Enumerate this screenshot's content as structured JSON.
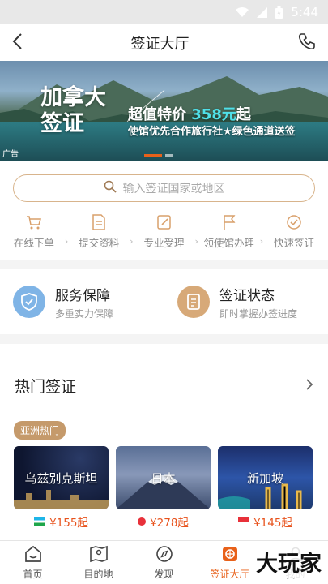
{
  "status_bar": {
    "time": "5:44"
  },
  "header": {
    "title": "签证大厅"
  },
  "banner": {
    "country_line1": "加拿大",
    "country_line2": "签证",
    "promo_prefix": "超值特价",
    "promo_price": "358元",
    "promo_suffix": "起",
    "subtitle": "使馆优先合作旅行社★绿色通道送签",
    "ad_label": "广告"
  },
  "search": {
    "placeholder": "输入签证国家或地区"
  },
  "steps": [
    {
      "label": "在线下单",
      "icon": "cart-icon"
    },
    {
      "label": "提交资料",
      "icon": "document-icon"
    },
    {
      "label": "专业受理",
      "icon": "edit-icon"
    },
    {
      "label": "领使馆办理",
      "icon": "flag-icon"
    },
    {
      "label": "快速签证",
      "icon": "check-circle-icon"
    }
  ],
  "services": [
    {
      "title": "服务保障",
      "subtitle": "多重实力保障",
      "icon": "shield-icon",
      "color": "#7fb4e6"
    },
    {
      "title": "签证状态",
      "subtitle": "即时掌握办签进度",
      "icon": "status-doc-icon",
      "color": "#d7a978"
    }
  ],
  "hot": {
    "title": "热门签证",
    "tag": "亚洲热门",
    "cards": [
      {
        "name": "乌兹别克斯坦",
        "price": "¥155起",
        "flag": "uzbekistan-flag"
      },
      {
        "name": "日本",
        "price": "¥278起",
        "flag": "japan-flag"
      },
      {
        "name": "新加坡",
        "price": "¥145起",
        "flag": "singapore-flag"
      }
    ]
  },
  "tabbar": [
    {
      "label": "首页",
      "icon": "home-icon"
    },
    {
      "label": "目的地",
      "icon": "map-icon"
    },
    {
      "label": "发现",
      "icon": "compass-icon"
    },
    {
      "label": "签证大厅",
      "icon": "visa-hall-icon"
    },
    {
      "label": "我的",
      "icon": "profile-icon"
    }
  ],
  "watermark": "大玩家",
  "colors": {
    "accent": "#e8611a",
    "price": "#e8531d",
    "gold": "#c59a6b"
  }
}
